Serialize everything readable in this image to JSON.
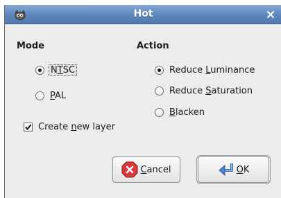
{
  "window": {
    "title": "Hot",
    "app_icon": "gimp-wilber-icon",
    "close_icon": "close-icon"
  },
  "mode": {
    "heading": "Mode",
    "options": [
      {
        "pre": "N",
        "key": "T",
        "post": "SC",
        "selected": true,
        "focused": true
      },
      {
        "pre": "",
        "key": "P",
        "post": "AL",
        "selected": false,
        "focused": false
      }
    ]
  },
  "action": {
    "heading": "Action",
    "options": [
      {
        "pre": "Reduce ",
        "key": "L",
        "post": "uminance",
        "selected": true
      },
      {
        "pre": "Reduce ",
        "key": "S",
        "post": "aturation",
        "selected": false
      },
      {
        "pre": "",
        "key": "B",
        "post": "lacken",
        "selected": false
      }
    ]
  },
  "create_layer": {
    "pre": "Create ",
    "key": "n",
    "post": "ew layer",
    "checked": true
  },
  "buttons": {
    "cancel": {
      "pre": "",
      "key": "C",
      "post": "ancel",
      "icon": "cancel-icon"
    },
    "ok": {
      "pre": "",
      "key": "O",
      "post": "K",
      "icon": "ok-icon"
    }
  },
  "colors": {
    "titlebar": "#5e86bb",
    "dialog_bg": "#ececec",
    "cancel_red": "#d83a3a",
    "ok_blue": "#4f7fc0"
  }
}
